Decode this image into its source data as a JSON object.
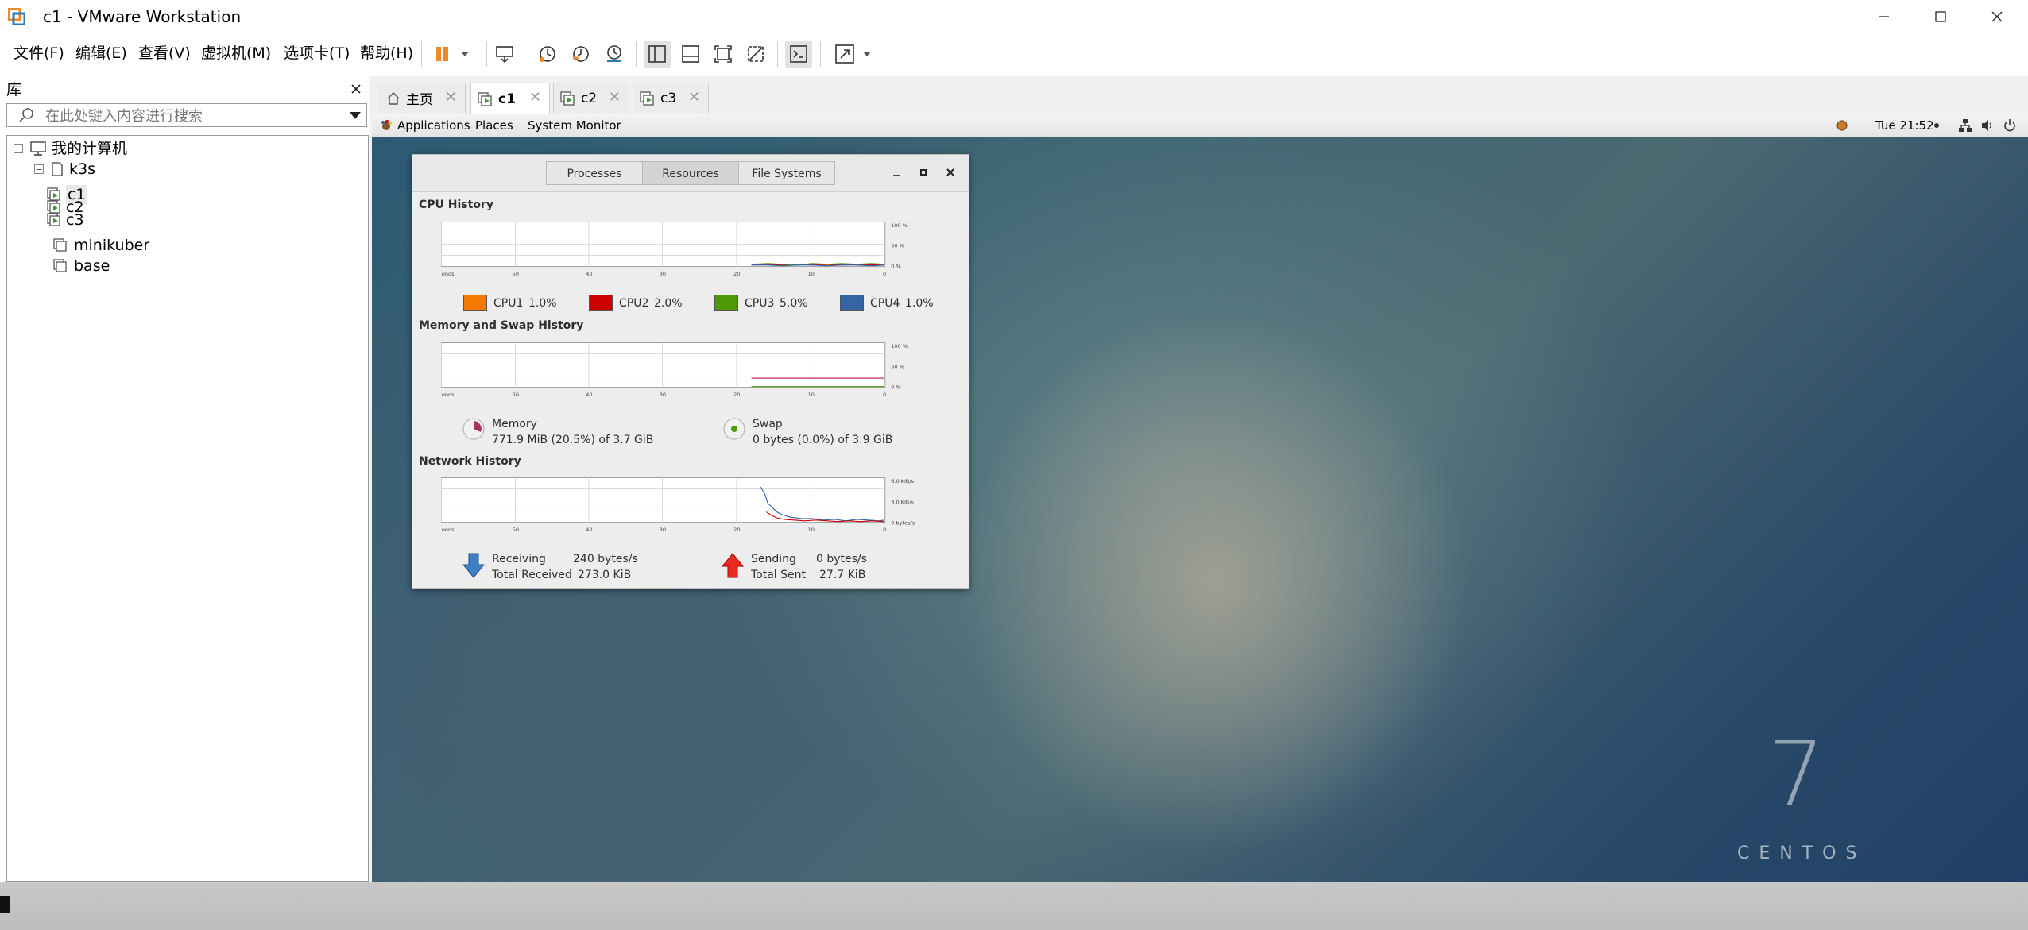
{
  "window": {
    "title": "c1 - VMware Workstation"
  },
  "menu": [
    "文件(F)",
    "编辑(E)",
    "查看(V)",
    "虚拟机(M)",
    "选项卡(T)",
    "帮助(H)"
  ],
  "library": {
    "title": "库",
    "search_placeholder": "在此处键入内容进行搜索",
    "tree": {
      "root": "我的计算机",
      "group": "k3s",
      "vms": [
        "c1",
        "c2",
        "c3"
      ],
      "others": [
        "minikuber",
        "base"
      ]
    }
  },
  "tabs": [
    {
      "label": "主页"
    },
    {
      "label": "c1"
    },
    {
      "label": "c2"
    },
    {
      "label": "c3"
    }
  ],
  "gnome": {
    "applications": "Applications",
    "places": "Places",
    "system_monitor": "System Monitor",
    "clock": "Tue 21:52"
  },
  "sysmon": {
    "tabs": [
      "Processes",
      "Resources",
      "File Systems"
    ],
    "cpu": {
      "title": "CPU History",
      "legend": [
        {
          "label": "CPU1",
          "value": "1.0%",
          "color": "#f57900"
        },
        {
          "label": "CPU2",
          "value": "2.0%",
          "color": "#cc0000"
        },
        {
          "label": "CPU3",
          "value": "5.0%",
          "color": "#4e9a06"
        },
        {
          "label": "CPU4",
          "value": "1.0%",
          "color": "#3465a4"
        }
      ],
      "y_ticks": [
        "100 %",
        "50 %",
        "0 %"
      ]
    },
    "memory": {
      "title": "Memory and Swap History",
      "mem_label": "Memory",
      "mem_value": "771.9 MiB (20.5%) of 3.7 GiB",
      "swap_label": "Swap",
      "swap_value": "0 bytes (0.0%) of 3.9 GiB",
      "y_ticks": [
        "100 %",
        "50 %",
        "0 %"
      ]
    },
    "network": {
      "title": "Network History",
      "receiving_label": "Receiving",
      "receiving_value": "240 bytes/s",
      "total_received_label": "Total Received",
      "total_received_value": "273.0 KiB",
      "sending_label": "Sending",
      "sending_value": "0 bytes/s",
      "total_sent_label": "Total Sent",
      "total_sent_value": "27.7 KiB",
      "y_ticks": [
        "6.0 KiB/s",
        "3.0 KiB/s",
        "0 bytes/s"
      ]
    },
    "x_ticks": [
      "60 seconds",
      "50",
      "40",
      "30",
      "20",
      "10",
      "0"
    ]
  },
  "desktop": {
    "brand_number": "7",
    "brand_text": "CENTOS"
  }
}
